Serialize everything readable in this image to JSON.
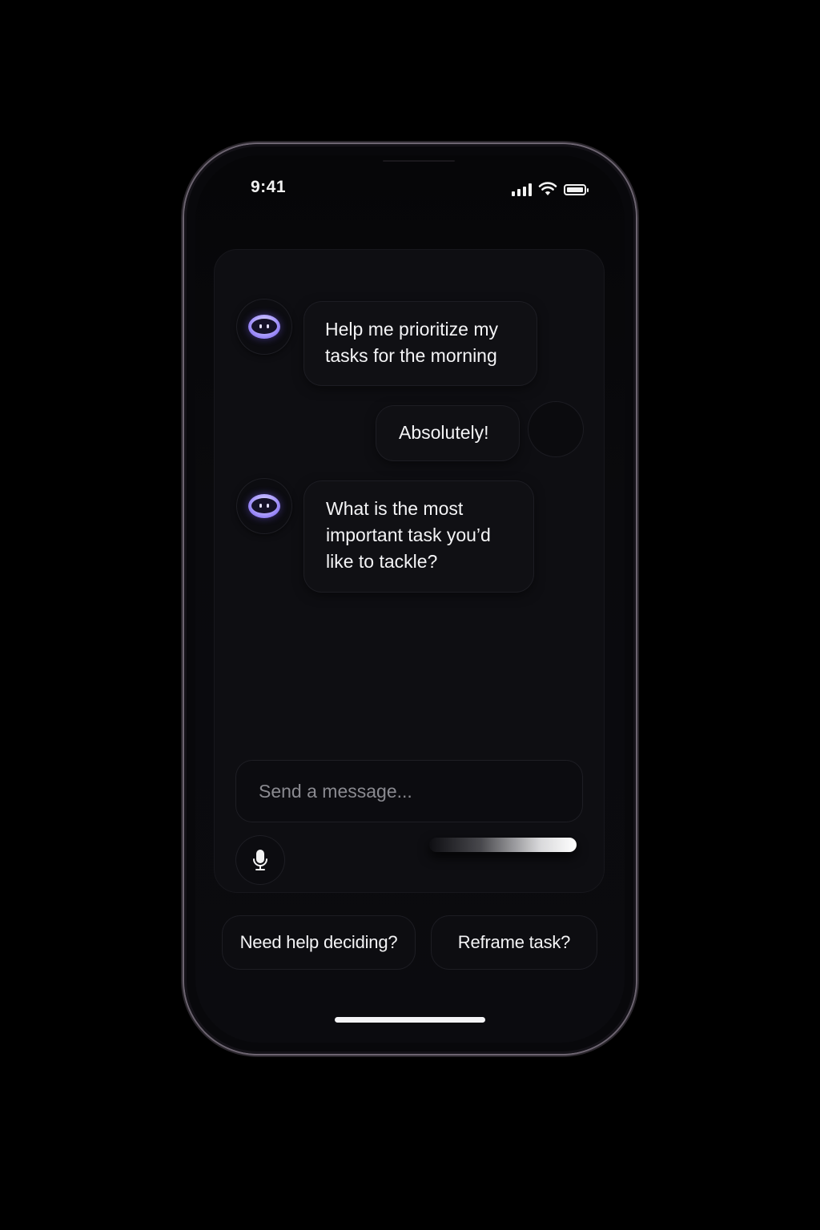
{
  "status_bar": {
    "time": "9:41",
    "icons": [
      "signal-icon",
      "wifi-icon",
      "battery-icon"
    ]
  },
  "chat": {
    "messages": [
      {
        "sender": "assistant",
        "avatar_icon": "robot-icon",
        "text": "Help me prioritize my\ntasks for the morning"
      },
      {
        "sender": "user",
        "text": "Absolutely!"
      },
      {
        "sender": "assistant",
        "avatar_icon": "robot-icon",
        "text": "What is the most\nimportant task you’d\nlike to tackle?"
      }
    ]
  },
  "composer": {
    "placeholder": "Send a message...",
    "value": "",
    "mic_icon": "microphone-icon"
  },
  "suggestions": [
    {
      "label": "Need help deciding?"
    },
    {
      "label": "Reframe task?"
    }
  ],
  "colors": {
    "background": "#000000",
    "screen": "#0a0a0d",
    "card": "#0e0e12",
    "text": "#f4f4f6",
    "placeholder": "#8a8a90",
    "accent": "#7b61ff"
  }
}
